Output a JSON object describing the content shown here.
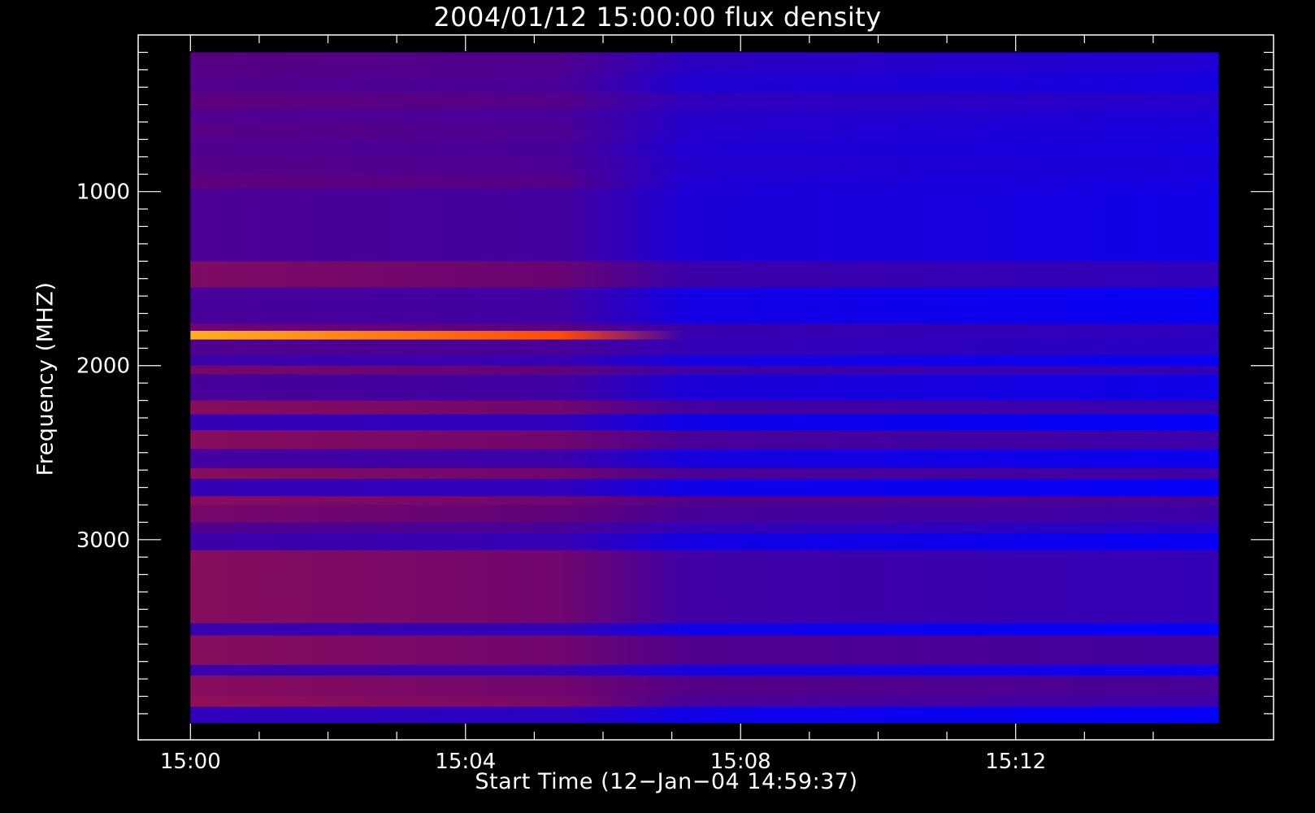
{
  "chart_data": {
    "type": "heatmap",
    "title": "2004/01/12 15:00:00 flux density",
    "xlabel": "Start Time (12−Jan−04 14:59:37)",
    "ylabel": "Frequency (MHZ)",
    "x_ticks": [
      {
        "value": 0,
        "label": "15:00"
      },
      {
        "value": 4,
        "label": "15:04"
      },
      {
        "value": 8,
        "label": "15:08"
      },
      {
        "value": 12,
        "label": "15:12"
      }
    ],
    "x_minor_step": 1,
    "x_range_minutes": [
      -0.76,
      15.75
    ],
    "data_x_range_minutes": [
      0,
      14.95
    ],
    "y_ticks": [
      {
        "value": 1000,
        "label": "1000"
      },
      {
        "value": 2000,
        "label": "2000"
      },
      {
        "value": 3000,
        "label": "3000"
      }
    ],
    "y_minor_step": 100,
    "y_range": [
      100,
      4150
    ],
    "data_y_range": [
      200,
      4050
    ],
    "y_inverted": true,
    "colors": {
      "background": "#000000",
      "axes": "#ffffff",
      "low": "#0000ff",
      "mid": "#5a0080",
      "high": "#ff3000",
      "peak": "#ffd020"
    },
    "transition_minute": 6.6,
    "bands": [
      {
        "from": 200,
        "to": 300,
        "early": 0.44,
        "late": 0.16
      },
      {
        "from": 300,
        "to": 360,
        "early": 0.42,
        "late": 0.12
      },
      {
        "from": 360,
        "to": 430,
        "early": 0.4,
        "late": 0.1
      },
      {
        "from": 430,
        "to": 520,
        "early": 0.46,
        "late": 0.18
      },
      {
        "from": 520,
        "to": 600,
        "early": 0.4,
        "late": 0.14
      },
      {
        "from": 600,
        "to": 700,
        "early": 0.43,
        "late": 0.12
      },
      {
        "from": 700,
        "to": 800,
        "early": 0.4,
        "late": 0.1
      },
      {
        "from": 800,
        "to": 900,
        "early": 0.42,
        "late": 0.12
      },
      {
        "from": 900,
        "to": 980,
        "early": 0.46,
        "late": 0.1
      },
      {
        "from": 980,
        "to": 1400,
        "early": 0.38,
        "late": 0.08
      },
      {
        "from": 1400,
        "to": 1550,
        "early": 0.54,
        "late": 0.24
      },
      {
        "from": 1550,
        "to": 1760,
        "early": 0.36,
        "late": 0.04
      },
      {
        "from": 1760,
        "to": 1800,
        "early": 0.5,
        "late": 0.24
      },
      {
        "from": 1800,
        "to": 1850,
        "early": 0.97,
        "late": 0.22
      },
      {
        "from": 1850,
        "to": 1940,
        "early": 0.4,
        "late": 0.2
      },
      {
        "from": 1940,
        "to": 2000,
        "early": 0.3,
        "late": 0.04
      },
      {
        "from": 2000,
        "to": 2050,
        "early": 0.52,
        "late": 0.26
      },
      {
        "from": 2050,
        "to": 2200,
        "early": 0.36,
        "late": 0.08
      },
      {
        "from": 2200,
        "to": 2280,
        "early": 0.56,
        "late": 0.28
      },
      {
        "from": 2280,
        "to": 2370,
        "early": 0.26,
        "late": 0.02
      },
      {
        "from": 2370,
        "to": 2480,
        "early": 0.56,
        "late": 0.3
      },
      {
        "from": 2480,
        "to": 2590,
        "early": 0.34,
        "late": 0.06
      },
      {
        "from": 2590,
        "to": 2650,
        "early": 0.56,
        "late": 0.32
      },
      {
        "from": 2650,
        "to": 2750,
        "early": 0.26,
        "late": 0.02
      },
      {
        "from": 2750,
        "to": 2800,
        "early": 0.56,
        "late": 0.36
      },
      {
        "from": 2800,
        "to": 2900,
        "early": 0.52,
        "late": 0.3
      },
      {
        "from": 2900,
        "to": 2960,
        "early": 0.4,
        "late": 0.2
      },
      {
        "from": 2960,
        "to": 3060,
        "early": 0.3,
        "late": 0.04
      },
      {
        "from": 3060,
        "to": 3480,
        "early": 0.56,
        "late": 0.26
      },
      {
        "from": 3480,
        "to": 3550,
        "early": 0.28,
        "late": 0.02
      },
      {
        "from": 3550,
        "to": 3720,
        "early": 0.56,
        "late": 0.34
      },
      {
        "from": 3720,
        "to": 3780,
        "early": 0.3,
        "late": 0.06
      },
      {
        "from": 3780,
        "to": 3900,
        "early": 0.56,
        "late": 0.36
      },
      {
        "from": 3900,
        "to": 3960,
        "early": 0.58,
        "late": 0.3
      },
      {
        "from": 3960,
        "to": 4050,
        "early": 0.24,
        "late": 0.02
      }
    ]
  }
}
